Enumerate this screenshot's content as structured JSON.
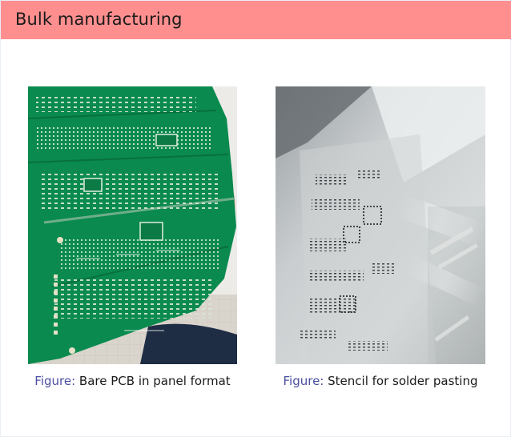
{
  "slide": {
    "title": "Bulk manufacturing"
  },
  "figures": [
    {
      "prefix": "Figure:",
      "caption": "Bare PCB in panel format"
    },
    {
      "prefix": "Figure:",
      "caption": "Stencil for solder pasting"
    }
  ],
  "colors": {
    "title_bar": "#ff8f8f",
    "caption_prefix": "#4a4fa0",
    "pcb_green": "#0a8a4e"
  }
}
